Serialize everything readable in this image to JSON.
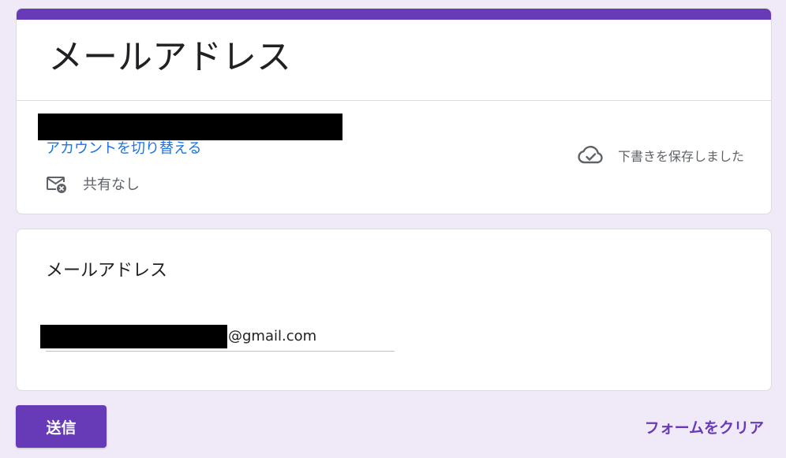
{
  "header": {
    "title": "メールアドレス",
    "switch_account_label": "アカウントを切り替える",
    "shared_label": "共有なし",
    "shared_icon": "mail-x-icon",
    "draft_status": "下書きを保存しました",
    "draft_icon": "cloud-check-icon"
  },
  "question": {
    "title": "メールアドレス",
    "email_suffix": "@gmail.com"
  },
  "footer": {
    "submit_label": "送信",
    "clear_label": "フォームをクリア"
  },
  "colors": {
    "accent": "#673ab7",
    "background": "#efe9f8",
    "link": "#1a73e8",
    "muted_text": "#5f6368"
  }
}
